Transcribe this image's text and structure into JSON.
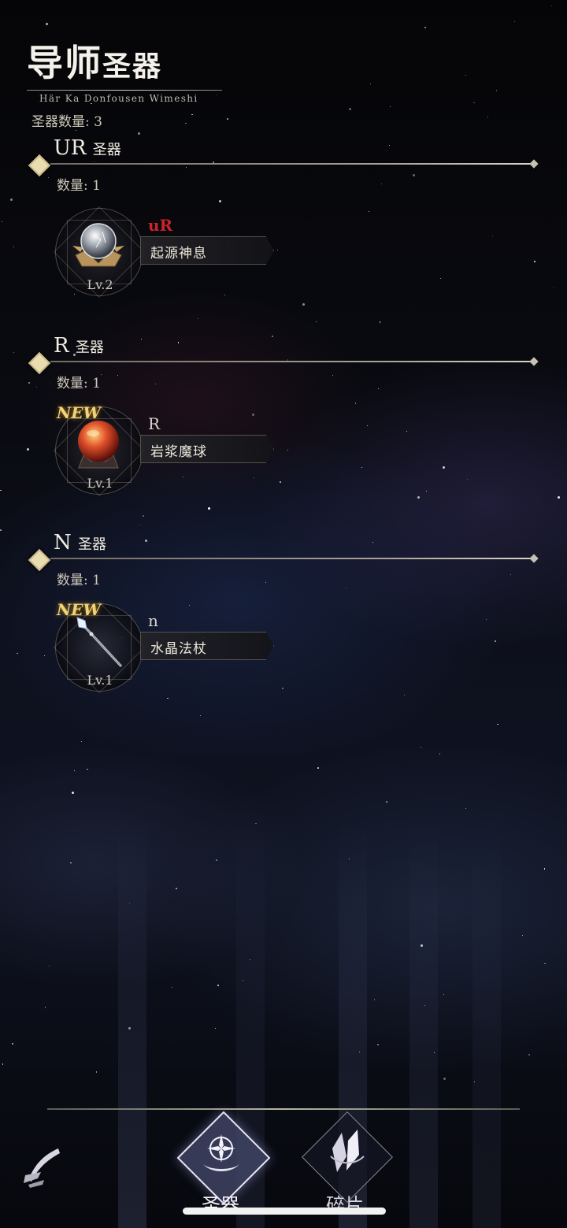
{
  "header": {
    "title_big": "导师",
    "title_small": "圣器",
    "subtitle": "Här Ka Donfousen Wimeshi",
    "total_count": "圣器数量: 3"
  },
  "sections": [
    {
      "rank": "UR",
      "suffix": "圣器",
      "count": "数量: 1",
      "item": {
        "rarity": "uR",
        "name": "起源神息",
        "level": "Lv.2",
        "new": "",
        "icon": "crystal-orb-icon"
      }
    },
    {
      "rank": "R",
      "suffix": "圣器",
      "count": "数量: 1",
      "item": {
        "rarity": "R",
        "name": "岩浆魔球",
        "level": "Lv.1",
        "new": "NEW",
        "icon": "magma-orb-icon"
      }
    },
    {
      "rank": "N",
      "suffix": "圣器",
      "count": "数量: 1",
      "item": {
        "rarity": "n",
        "name": "水晶法杖",
        "level": "Lv.1",
        "new": "NEW",
        "icon": "crystal-staff-icon"
      }
    }
  ],
  "nav": {
    "back_icon": "feather-back-icon",
    "artifact_label": "圣器",
    "fragment_label": "碎片"
  },
  "colors": {
    "ur_rarity": "#c8242a",
    "r_rarity": "#d8d6d0",
    "n_rarity": "#d8d6d0",
    "new_tag": "#f1d47a"
  }
}
